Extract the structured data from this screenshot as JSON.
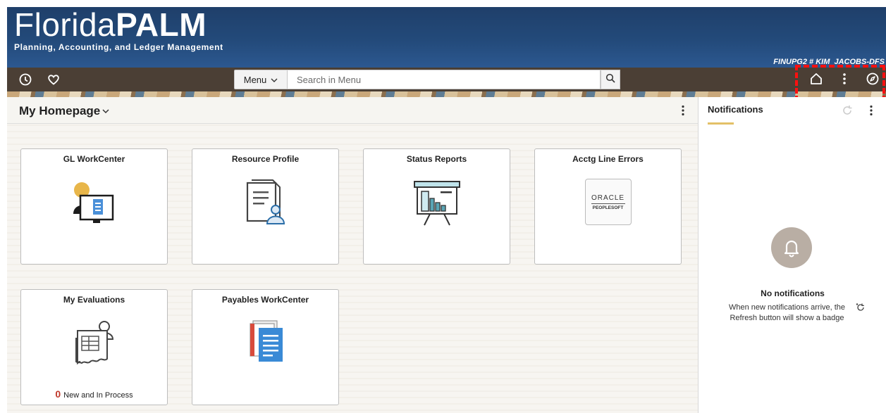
{
  "banner": {
    "logo_main_thin": "Florida",
    "logo_main_bold": "PALM",
    "logo_sub": "Planning, Accounting, and Ledger Management",
    "user_id": "FINUPG2 # KIM_JACOBS-DFS"
  },
  "navbar": {
    "recent_icon": "clock-icon",
    "favorites_icon": "heart-icon",
    "menu_label": "Menu",
    "search_placeholder": "Search in Menu",
    "search_icon": "search-icon",
    "home_icon": "home-icon",
    "actions_icon": "kebab-icon",
    "navbar_icon": "compass-icon"
  },
  "homepage": {
    "title": "My Homepage"
  },
  "tiles": [
    {
      "title": "GL WorkCenter"
    },
    {
      "title": "Resource Profile"
    },
    {
      "title": "Status Reports"
    },
    {
      "title": "Acctg Line Errors",
      "logo_line1": "ORACLE",
      "logo_line2": "PEOPLESOFT"
    },
    {
      "title": "My Evaluations",
      "count": "0",
      "count_label": "New and In Process"
    },
    {
      "title": "Payables WorkCenter"
    }
  ],
  "notifications": {
    "title": "Notifications",
    "empty_title": "No notifications",
    "empty_message": "When new notifications arrive, the Refresh button will show a badge"
  },
  "colors": {
    "banner": "#234a7a",
    "navbar": "#4b3f35",
    "highlight": "#ff1010",
    "count": "#c0392b",
    "accent": "#e3c067"
  }
}
